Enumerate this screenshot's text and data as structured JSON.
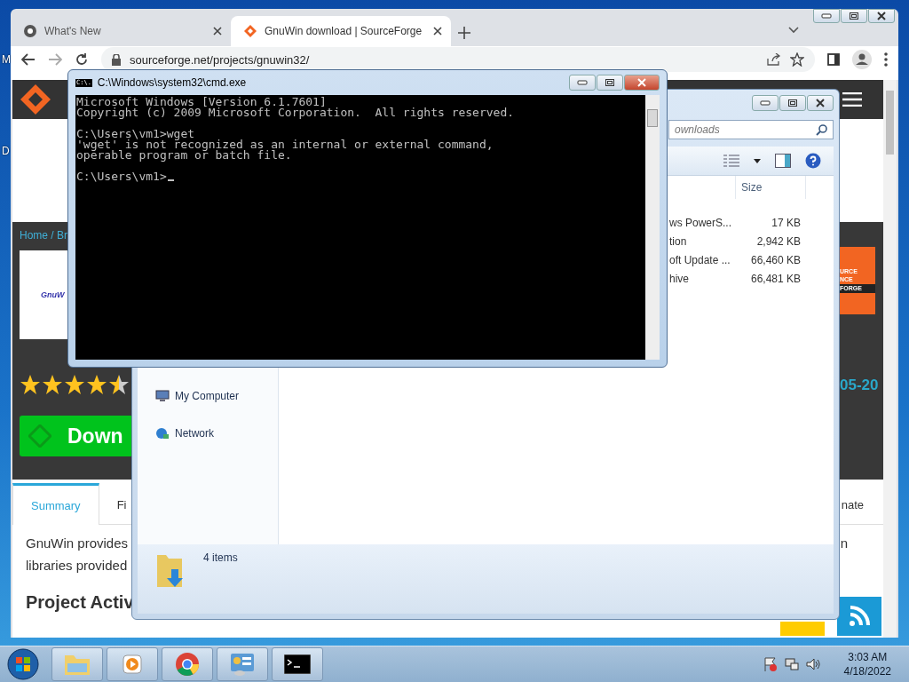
{
  "desktop": {
    "edge_labels": [
      "M",
      "D"
    ]
  },
  "browser": {
    "tabs": [
      {
        "title": "What's New",
        "selected": false
      },
      {
        "title": "GnuWin download | SourceForge",
        "selected": true
      }
    ],
    "address": "sourceforge.net/projects/gnuwin32/",
    "page": {
      "breadcrumb": "Home / Br",
      "logo_text": "GnuW",
      "stars": 4.5,
      "download_label": "Down",
      "badge_lines": [
        "URCE",
        "NCE",
        "FORGE"
      ],
      "date_fragment": "05-20",
      "tabs": [
        {
          "label": "Summary",
          "selected": true
        },
        {
          "label": "Fi",
          "selected": false
        },
        {
          "label": "nate",
          "selected": false
        }
      ],
      "description": [
        "GnuWin provides",
        "libraries provided"
      ],
      "description_tail": "n",
      "heading": "Project Activ"
    }
  },
  "explorer": {
    "search_placeholder": "ownloads",
    "columns": [
      "Size"
    ],
    "rows": [
      {
        "name": "ws PowerS...",
        "size": "17 KB"
      },
      {
        "name": "tion",
        "size": "2,942 KB"
      },
      {
        "name": "oft Update ...",
        "size": "66,460 KB"
      },
      {
        "name": "hive",
        "size": "66,481 KB"
      }
    ],
    "nav": [
      "My Computer",
      "Network"
    ],
    "status": "4 items"
  },
  "cmd": {
    "title": "C:\\Windows\\system32\\cmd.exe",
    "icon_text": "C:\\.",
    "blocks": [
      [
        "Microsoft Windows [Version 6.1.7601]",
        "Copyright (c) 2009 Microsoft Corporation.  All rights reserved."
      ],
      [
        "C:\\Users\\vm1>wget",
        "'wget' is not recognized as an internal or external command,",
        "operable program or batch file."
      ],
      [
        "C:\\Users\\vm1>"
      ]
    ]
  },
  "taskbar": {
    "time": "3:03 AM",
    "date": "4/18/2022"
  }
}
